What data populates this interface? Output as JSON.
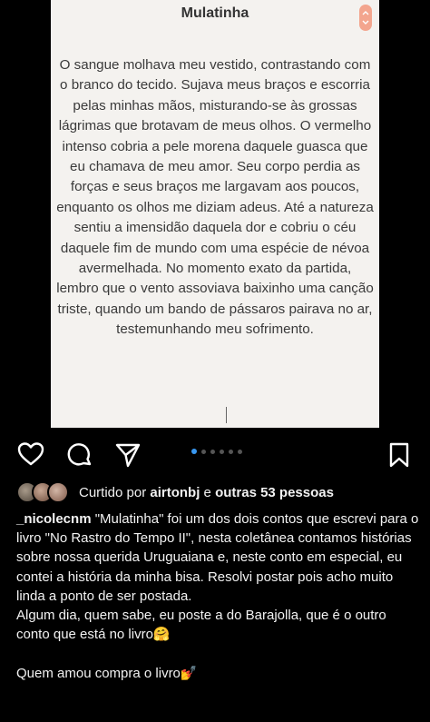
{
  "post": {
    "title": "Mulatinha",
    "scroll_icon": "chevron-up-down-icon",
    "story": "O sangue molhava meu vestido, contrastando com o branco do tecido. Sujava meus braços e escorria pelas minhas mãos, misturando-se às grossas lágrimas que brotavam de meus olhos. O vermelho intenso cobria a pele morena daquele guasca que eu chamava de meu amor. Seu corpo perdia as forças e seus braços me largavam aos poucos, enquanto os olhos me diziam adeus. Até a natureza sentiu a imensidão daquela dor e cobriu o céu daquele fim de mundo com uma espécie de névoa avermelhada. No momento exato da partida, lembro que o vento assoviava baixinho uma canção triste, quando um bando de pássaros pairava no ar, testemunhando meu sofrimento."
  },
  "actions": {
    "like_icon": "heart-icon",
    "comment_icon": "comment-icon",
    "share_icon": "paper-plane-icon",
    "save_icon": "bookmark-icon",
    "carousel_total": 6,
    "carousel_active": 1
  },
  "likes": {
    "prefix": "Curtido por ",
    "user": "airtonbj",
    "middle": " e ",
    "others": "outras 53 pessoas"
  },
  "caption": {
    "username": "_nicolecnm",
    "text": " \"Mulatinha\" foi um dos dois contos que escrevi para o livro \"No Rastro do Tempo II\", nesta coletânea contamos histórias sobre nossa querida Uruguaiana e, neste conto em especial, eu contei a história da minha bisa. Resolvi postar pois acho muito linda a ponto de ser postada.",
    "line2": "Algum dia, quem sabe, eu poste a do Barajolla, que é o outro conto que está no livro🤗",
    "line3": "Quem amou compra o livro💅"
  }
}
